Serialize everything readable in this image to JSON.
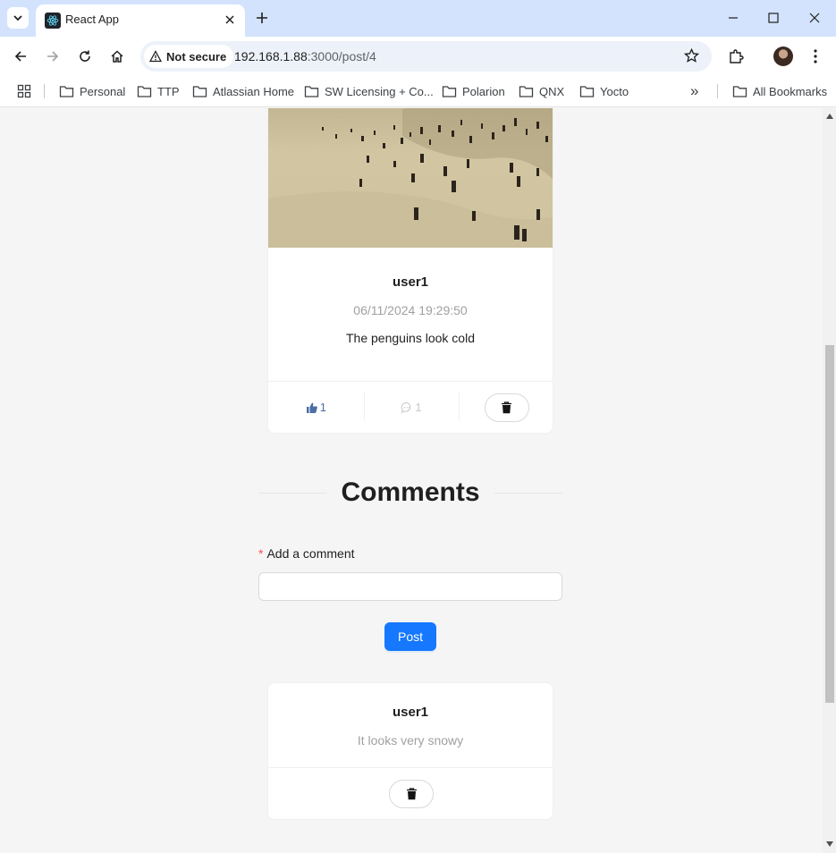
{
  "browser": {
    "tab_title": "React App",
    "security_label": "Not secure",
    "url_host": "192.168.1.88",
    "url_path": ":3000/post/4",
    "bookmarks": [
      "Personal",
      "TTP",
      "Atlassian Home",
      "SW Licensing + Co...",
      "Polarion",
      "QNX",
      "Yocto"
    ],
    "all_bookmarks": "All Bookmarks",
    "overflow": "»"
  },
  "post": {
    "username": "user1",
    "timestamp": "06/11/2024 19:29:50",
    "text": "The penguins look cold",
    "likes": "1",
    "comments": "1"
  },
  "comments_section": {
    "title": "Comments",
    "required_mark": "*",
    "label": "Add a comment",
    "input_value": "",
    "post_button": "Post"
  },
  "comments": [
    {
      "username": "user1",
      "text": "It looks very snowy"
    }
  ],
  "colors": {
    "primary": "#1677ff",
    "chrome_tabbar": "#d3e3fd",
    "required": "#ff4d4f"
  }
}
